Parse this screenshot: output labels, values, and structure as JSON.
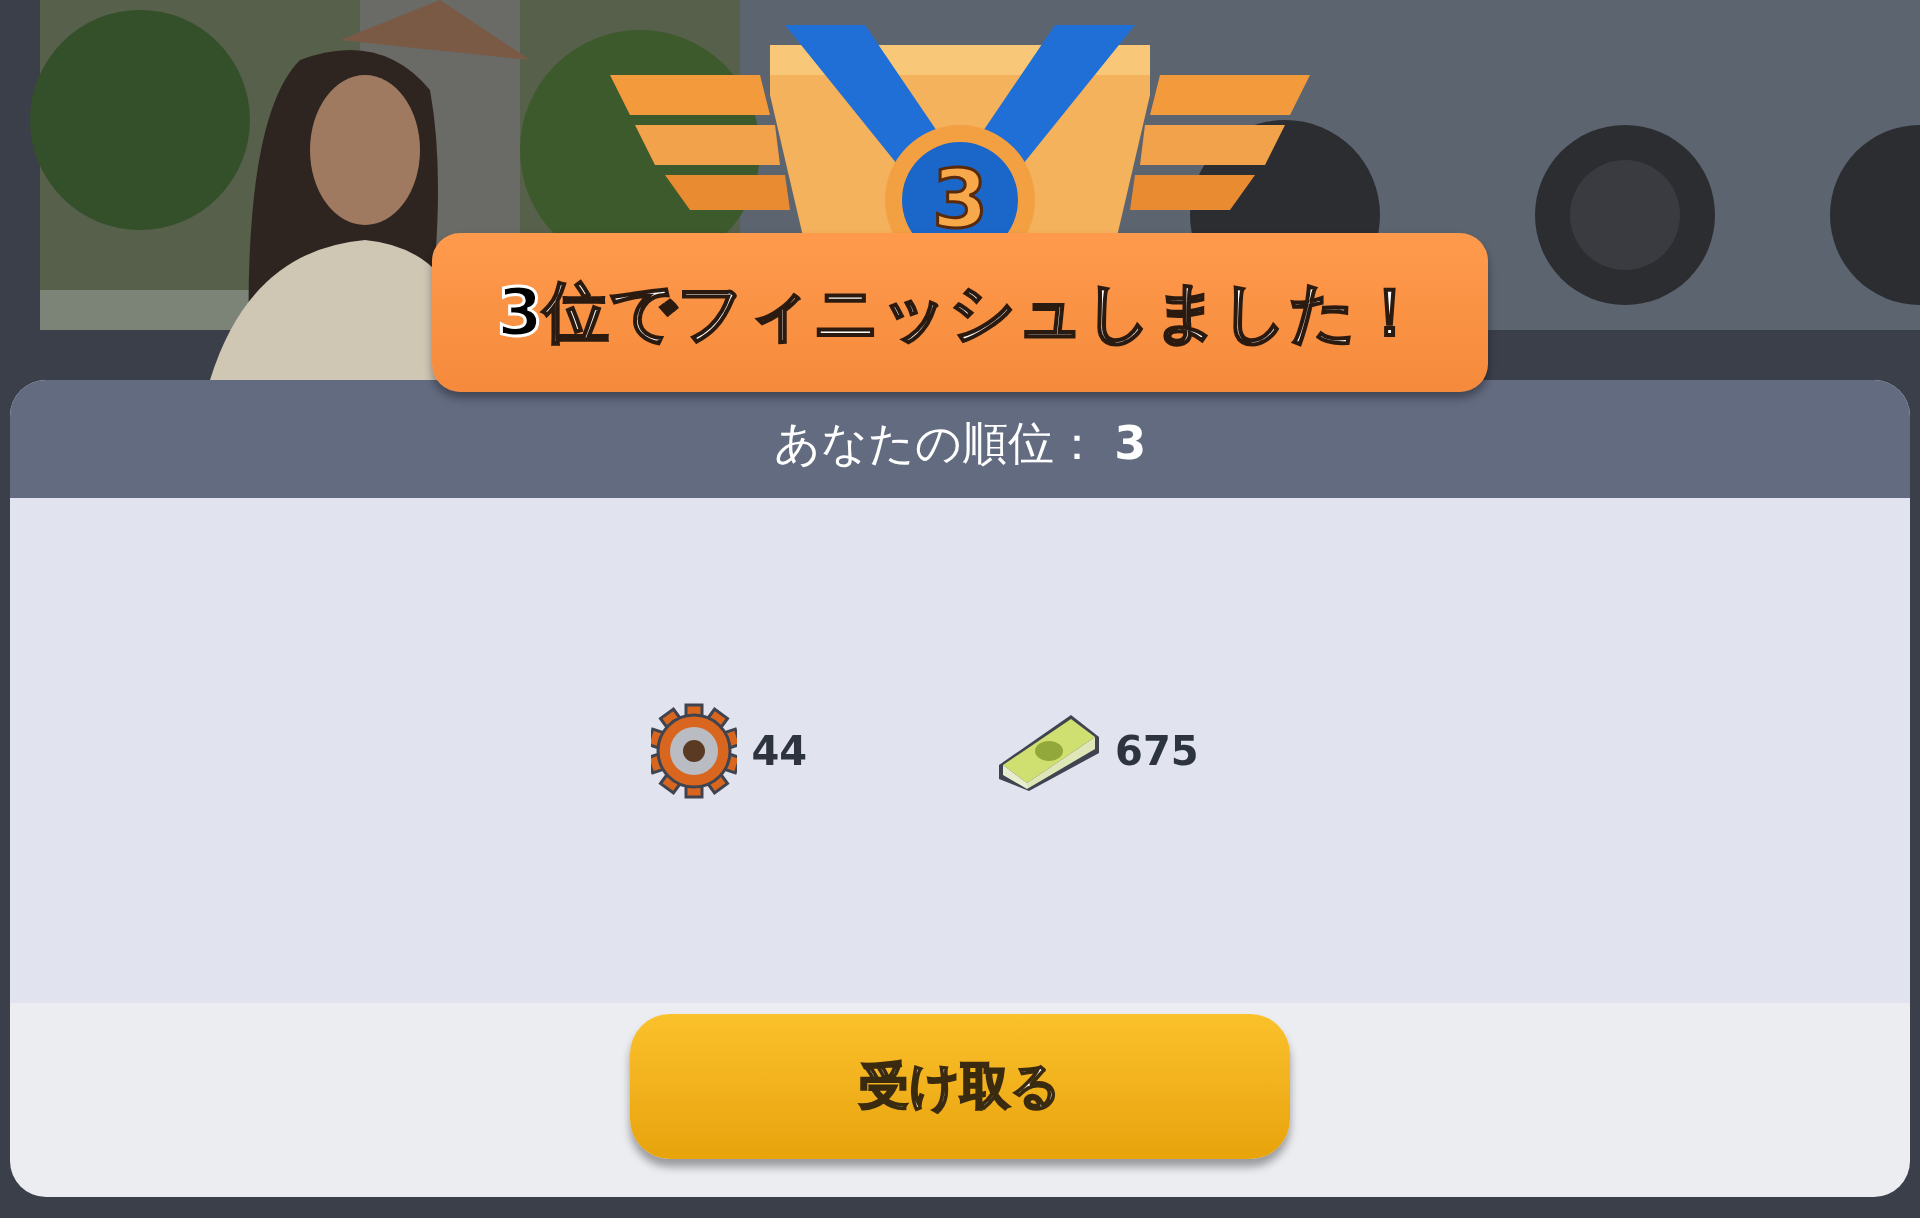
{
  "medal": {
    "rank": "3"
  },
  "banner": {
    "title": "**3**位でフィニッシュしました！"
  },
  "dialog": {
    "rank_line": "あなたの順位： **3**",
    "rewards": [
      {
        "kind": "gears",
        "amount": "44"
      },
      {
        "kind": "cash",
        "amount": "675"
      }
    ],
    "button": "受け取る"
  }
}
